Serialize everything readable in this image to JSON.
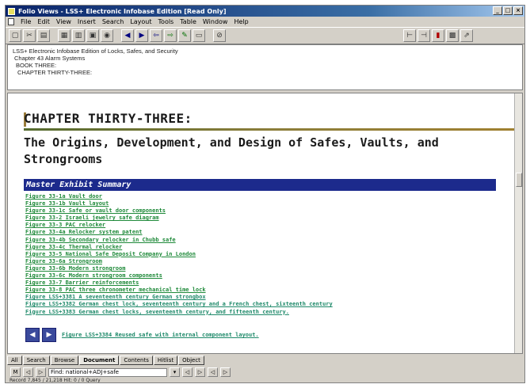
{
  "window": {
    "title": "Folio Views - LSS+ Electronic Infobase Edition [Read Only]",
    "controls": [
      "_",
      "□",
      "×"
    ]
  },
  "menu": [
    "File",
    "Edit",
    "View",
    "Insert",
    "Search",
    "Layout",
    "Tools",
    "Table",
    "Window",
    "Help"
  ],
  "toolbar": {
    "buttons": [
      "▢",
      "✂",
      "▤",
      "▦",
      "▥",
      "▣",
      "◉",
      "◀",
      "▶",
      "⇦",
      "⇨",
      "✎",
      "▭",
      "⊘",
      "⊢",
      "⊣",
      "▮",
      "▩",
      "⇗"
    ]
  },
  "breadcrumb": [
    "LSS+ Electronic Infobase Edition of Locks, Safes, and Security",
    "Chapter 43 Alarm Systems",
    "BOOK THREE:",
    "CHAPTER THIRTY-THREE:"
  ],
  "document": {
    "chapter_heading": "CHAPTER THIRTY-THREE:",
    "subtitle": "The Origins, Development, and Design of Safes, Vaults, and Strongrooms",
    "summary_heading": "Master Exhibit Summary",
    "figures": [
      "Figure 33-1a Vault door",
      "Figure 33-1b Vault layout",
      "Figure 33-1c Safe or vault door components",
      "Figure 33-2 Israeli jewelry safe diagram",
      "Figure 33-3 PAC relocker",
      "Figure 33-4a Relocker system patent",
      "Figure 33-4b Secondary relocker in Chubb safe",
      "Figure 33-4c Thermal relocker",
      "Figure 33-5 National Safe Deposit Company in London",
      "Figure 33-6a Strongroom",
      "Figure 33-6b Modern strongroom",
      "Figure 33-6c Modern strongroom components",
      "Figure 33-7 Barrier reinforcements",
      "Figure 33-8 PAC three chronometer mechanical time lock",
      "Figure LSS+3381 A seventeenth century German strongbox",
      "Figure LSS+3382 German chest lock, seventeenth century and a French chest, sixteenth century",
      "Figure LSS+3383 German chest locks, seventeenth century, and fifteenth century."
    ],
    "last_figure": "Figure LSS+3384 Reused safe with internal component layout.",
    "nav_prev": "◀",
    "nav_next": "▶"
  },
  "tabs": [
    "All",
    "Search",
    "Browse",
    "Document",
    "Contents",
    "Hitlist",
    "Object"
  ],
  "search": {
    "query": "Find: national+ADJ+safe",
    "buttons": [
      "M",
      "◁",
      "▷",
      "◁",
      "▷",
      "▾",
      "◁",
      "▷",
      "◁",
      "▷"
    ]
  },
  "status": "Record 7,845 / 21,218  Hit: 0 / 0  Query"
}
